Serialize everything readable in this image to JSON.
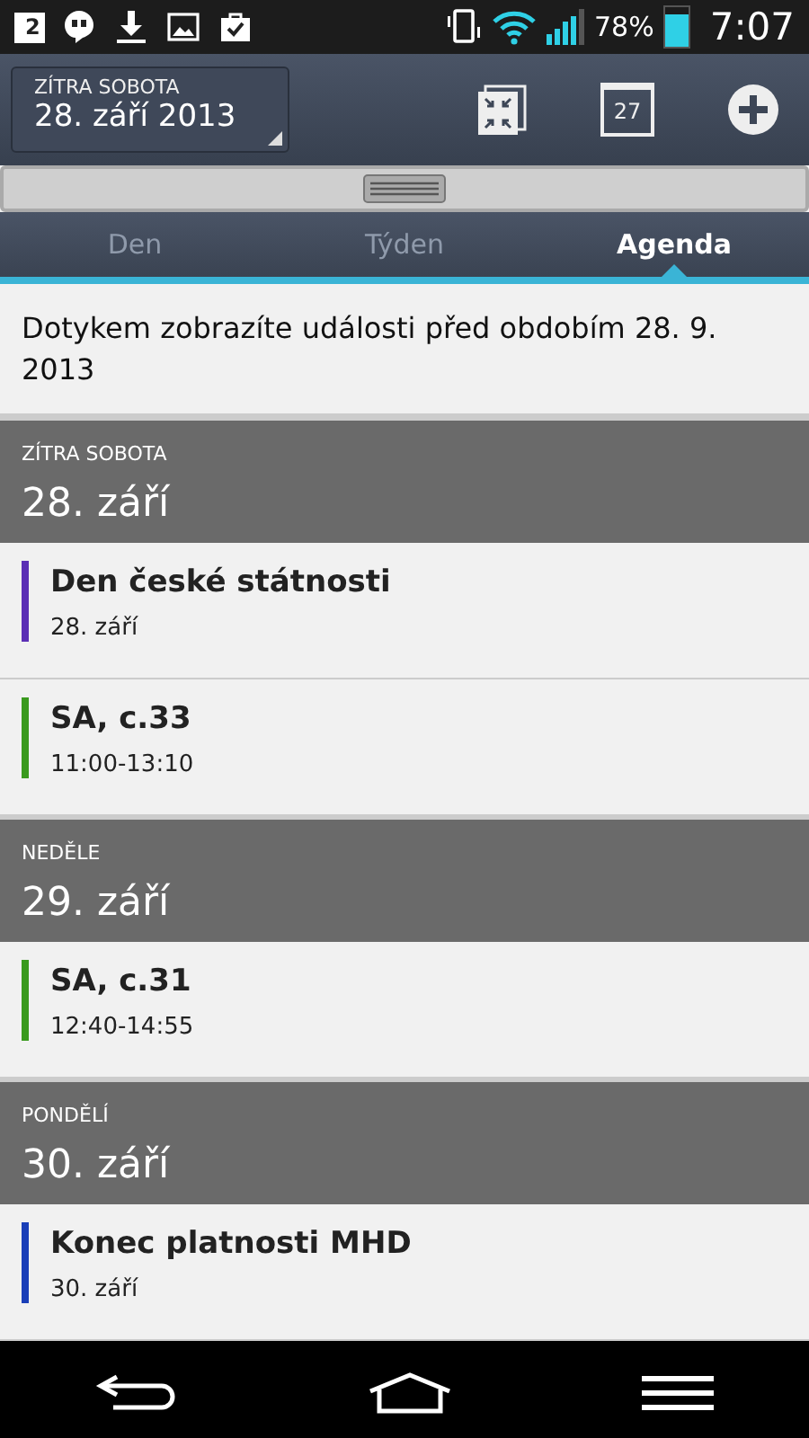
{
  "status_bar": {
    "notification_count": "2",
    "battery_percent": "78%",
    "time": "7:07"
  },
  "header": {
    "caption": "ZÍTRA SOBOTA",
    "date": "28. září 2013",
    "calendar_day": "27"
  },
  "tabs": [
    {
      "label": "Den",
      "selected": false
    },
    {
      "label": "Týden",
      "selected": false
    },
    {
      "label": "Agenda",
      "selected": true
    }
  ],
  "notice": "Dotykem zobrazíte události před obdobím 28. 9. 2013",
  "days": [
    {
      "weekday": "ZÍTRA SOBOTA",
      "date": "28. září",
      "events": [
        {
          "title": "Den české státnosti",
          "time": "28. září",
          "color": "#5b2fb5"
        },
        {
          "title": "SA, c.33",
          "time": "11:00-13:10",
          "color": "#3a9a1e"
        }
      ]
    },
    {
      "weekday": "NEDĚLE",
      "date": "29. září",
      "events": [
        {
          "title": "SA, c.31",
          "time": "12:40-14:55",
          "color": "#3a9a1e"
        }
      ]
    },
    {
      "weekday": "PONDĚLÍ",
      "date": "30. září",
      "events": [
        {
          "title": "Konec platnosti MHD",
          "time": "30. září",
          "color": "#1a3fb8"
        }
      ]
    }
  ]
}
